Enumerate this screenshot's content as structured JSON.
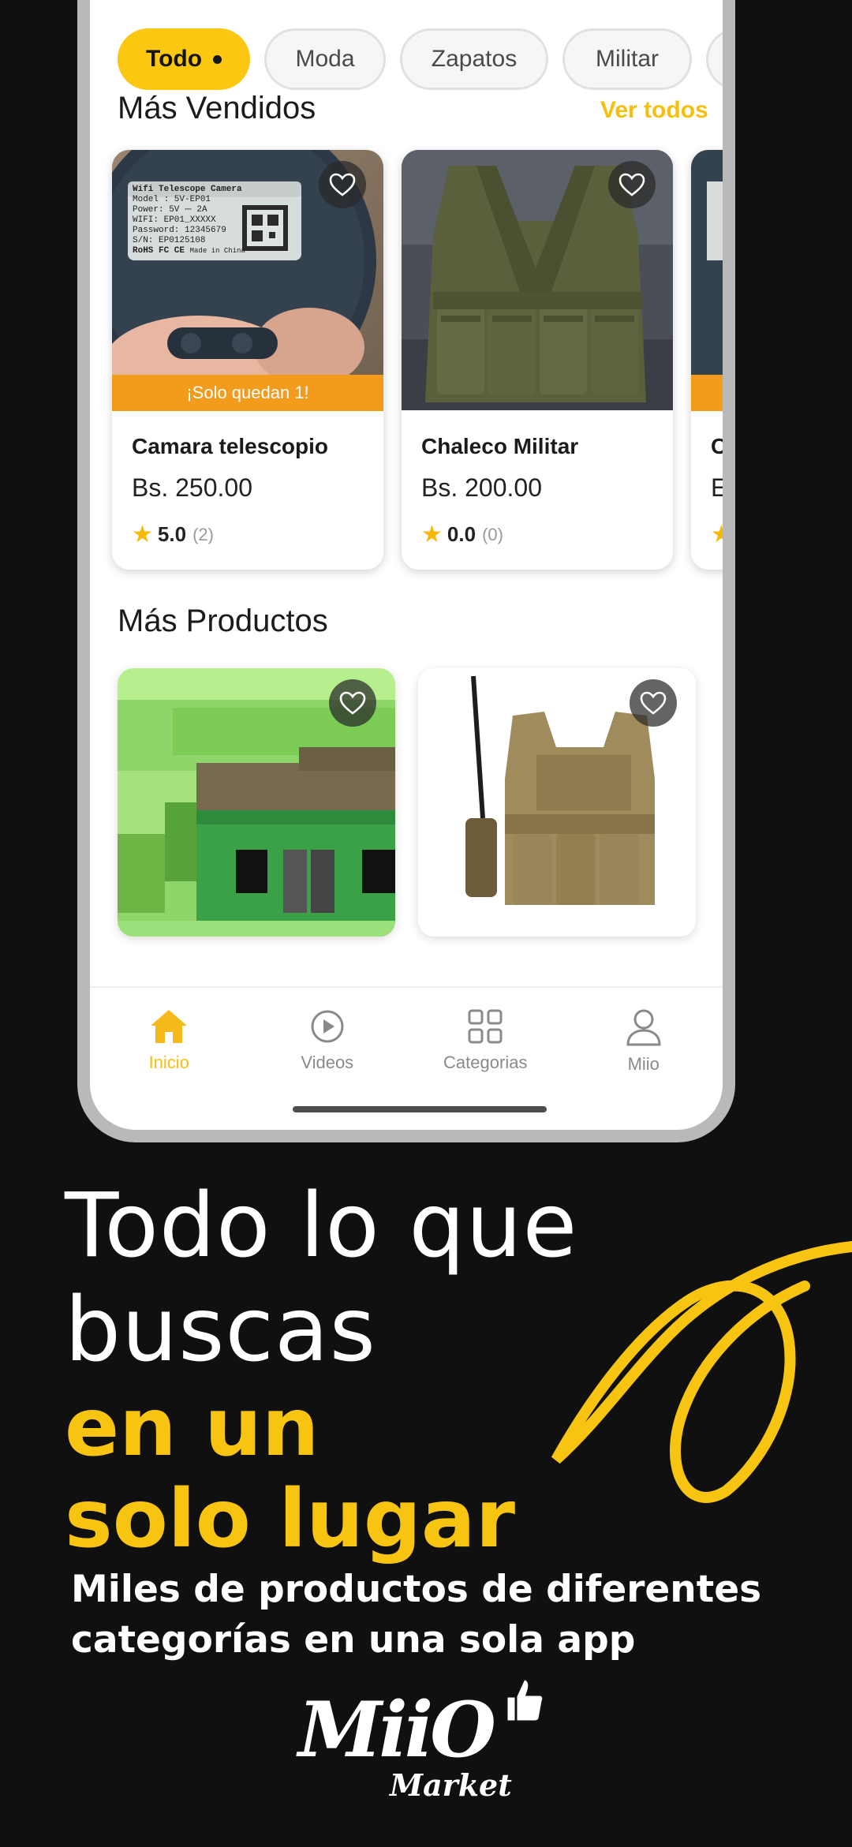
{
  "categories": {
    "items": [
      {
        "label": "Todo",
        "active": true
      },
      {
        "label": "Moda"
      },
      {
        "label": "Zapatos"
      },
      {
        "label": "Militar"
      }
    ]
  },
  "best_sellers": {
    "title": "Más Vendidos",
    "see_all": "Ver todos",
    "products": [
      {
        "name": "Camara telescopio",
        "price": "Bs. 250.00",
        "rating": "5.0",
        "rating_count": "(2)",
        "badge": "¡Solo quedan 1!",
        "label_text": {
          "title": "Wifi Telescope Camera",
          "model": "Model : 5V-EP01",
          "power": "Power: 5V ⎓ 2A",
          "wifi": "WIFI: EP01_XXXXX",
          "password": "Password: 12345679",
          "sn": "S/N: EP0125108",
          "rohs": "RoHS FC CE",
          "made": "Made in China"
        }
      },
      {
        "name": "Chaleco Militar",
        "price": "Bs. 200.00",
        "rating": "0.0",
        "rating_count": "(0)"
      },
      {
        "name": "C",
        "price": "E"
      }
    ]
  },
  "more_products": {
    "title": "Más Productos"
  },
  "bottom_nav": {
    "items": [
      {
        "label": "Inicio",
        "icon": "home-icon",
        "active": true
      },
      {
        "label": "Videos",
        "icon": "play-icon"
      },
      {
        "label": "Categorias",
        "icon": "grid-icon"
      },
      {
        "label": "Miio",
        "icon": "user-icon"
      }
    ]
  },
  "headline": {
    "line1": "Todo lo que",
    "line2": "buscas",
    "line3": "en un",
    "line4": "solo lugar",
    "sub1": "Miles de productos de diferentes",
    "sub2": "categorías en una sola app"
  },
  "logo": {
    "main": "MiiO",
    "sub": "Market"
  },
  "colors": {
    "accent": "#fbc711",
    "badge": "#f39b1c",
    "background": "#111010"
  }
}
